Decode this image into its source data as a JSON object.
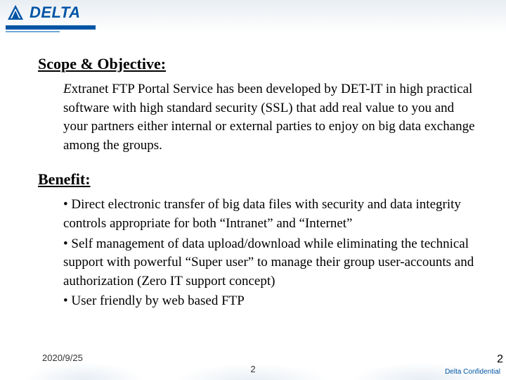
{
  "brand": {
    "name": "DELTA"
  },
  "sections": {
    "scope": {
      "title": "Scope & Objective:",
      "first_letter": "E",
      "rest": "xtranet FTP Portal Service has been developed by DET-IT in high practical software with high standard security (SSL) that add real value to you and your partners either internal or external parties to enjoy on big data exchange among the groups."
    },
    "benefit": {
      "title": "Benefit:",
      "items": [
        "•  Direct electronic transfer of big data files with security and data integrity controls appropriate for both “Intranet” and “Internet”",
        "•  Self management of data upload/download while eliminating the technical support with powerful “Super user” to manage their group user-accounts and authorization (Zero IT support concept)",
        "• User friendly by web based FTP"
      ]
    }
  },
  "footer": {
    "date": "2020/9/25",
    "page_center": "2",
    "page_right": "2",
    "confidential": "Delta Confidential"
  }
}
